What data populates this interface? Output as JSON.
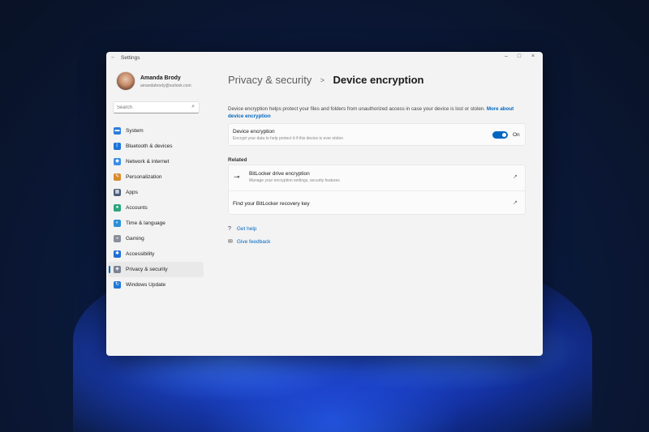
{
  "window": {
    "title": "Settings",
    "back": "←",
    "minimize": "–",
    "maximize": "□",
    "close": "×"
  },
  "user": {
    "name": "Amanda Brody",
    "email": "amandabrody@outlook.com"
  },
  "search": {
    "placeholder": "Search",
    "icon": "⌕"
  },
  "nav": [
    {
      "label": "System",
      "icon": "system-icon",
      "glyph": "▬",
      "color": "#2b7de0",
      "active": false
    },
    {
      "label": "Bluetooth & devices",
      "icon": "bluetooth-icon",
      "glyph": "ᛒ",
      "color": "#1a73d9",
      "active": false
    },
    {
      "label": "Network & internet",
      "icon": "network-icon",
      "glyph": "◆",
      "color": "#3b8ee8",
      "active": false
    },
    {
      "label": "Personalization",
      "icon": "brush-icon",
      "glyph": "✎",
      "color": "#d98a2b",
      "active": false
    },
    {
      "label": "Apps",
      "icon": "apps-icon",
      "glyph": "▦",
      "color": "#4a5d7a",
      "active": false
    },
    {
      "label": "Accounts",
      "icon": "accounts-icon",
      "glyph": "●",
      "color": "#2aa77a",
      "active": false
    },
    {
      "label": "Time & language",
      "icon": "globe-icon",
      "glyph": "◐",
      "color": "#2a8fd9",
      "active": false
    },
    {
      "label": "Gaming",
      "icon": "gaming-icon",
      "glyph": "◒",
      "color": "#8a8f9a",
      "active": false
    },
    {
      "label": "Accessibility",
      "icon": "accessibility-icon",
      "glyph": "✱",
      "color": "#1d6fd4",
      "active": false
    },
    {
      "label": "Privacy & security",
      "icon": "shield-icon",
      "glyph": "◈",
      "color": "#7a8190",
      "active": true
    },
    {
      "label": "Windows Update",
      "icon": "update-icon",
      "glyph": "↻",
      "color": "#1f78d8",
      "active": false
    }
  ],
  "breadcrumb": {
    "parent": "Privacy & security",
    "separator": ">",
    "current": "Device encryption"
  },
  "description": {
    "text": "Device encryption helps protect your files and folders from unauthorized access in case your device is lost or stolen.",
    "link": "More about device encryption"
  },
  "encryption": {
    "title": "Device encryption",
    "subtitle": "Encrypt your data to help protect it if this device is ever stolen",
    "state": "On"
  },
  "related": {
    "heading": "Related",
    "items": [
      {
        "title": "BitLocker drive encryption",
        "subtitle": "Manage your encryption settings, security features",
        "icon": "usb-key-icon",
        "glyph": "⊸",
        "ext": "↗"
      },
      {
        "title": "Find your BitLocker recovery key",
        "subtitle": "",
        "icon": "",
        "glyph": "",
        "ext": "↗"
      }
    ]
  },
  "help": [
    {
      "label": "Get help",
      "icon": "help-icon",
      "glyph": "?"
    },
    {
      "label": "Give feedback",
      "icon": "feedback-icon",
      "glyph": "✉"
    }
  ],
  "colors": {
    "accent": "#0067c0",
    "window_bg": "#f3f3f3",
    "card_bg": "#fbfbfb"
  }
}
